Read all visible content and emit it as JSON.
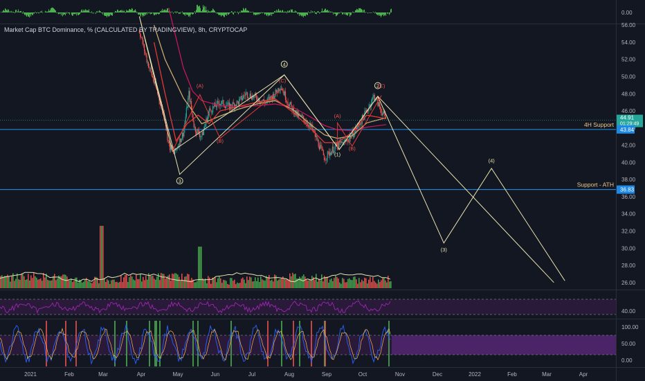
{
  "header": {
    "symbol_title": "Market Cap BTC Dominance, % (CALCULATED BY TRADINGVIEW), 8h, CRYPTOCAP"
  },
  "colors": {
    "background": "#131722",
    "up": "#26a69a",
    "up_volume": "#4caf50",
    "down": "#ef5350",
    "wave_line": "#e8e3b0",
    "ma_pink": "#c2185b",
    "ma_gold": "#c8a96e",
    "ma_red": "#e53935",
    "hline": "#2196f3",
    "rsi": "#9c27b0",
    "stoch_k": "#2962ff",
    "stoch_d": "#ffb74d",
    "axis_text": "#b2b5be",
    "price_badge": "#26a69a",
    "level_badge": "#1e88e5"
  },
  "chart_data": [
    {
      "type": "line",
      "pane": "top-oscillator",
      "y_ticks": [
        "0.00"
      ]
    },
    {
      "type": "candlestick",
      "pane": "main",
      "title": "Market Cap BTC Dominance, % (CALCULATED BY TRADINGVIEW), 8h, CRYPTOCAP",
      "ylim": [
        25.5,
        56.5
      ],
      "y_ticks": [
        "56.00",
        "54.00",
        "52.00",
        "50.00",
        "48.00",
        "46.00",
        "44.00",
        "42.00",
        "40.00",
        "38.00",
        "36.00",
        "34.00",
        "32.00",
        "30.00",
        "28.00",
        "26.00"
      ],
      "x_ticks": [
        "2021",
        "Feb",
        "Mar",
        "Apr",
        "May",
        "Jun",
        "Jul",
        "Aug",
        "Sep",
        "Oct",
        "Nov",
        "Dec",
        "2022",
        "Feb",
        "Mar",
        "Apr"
      ],
      "price_path": [
        [
          0,
          72
        ],
        [
          1,
          70.5
        ],
        [
          2,
          69.8
        ],
        [
          3,
          68
        ],
        [
          4,
          65
        ],
        [
          5,
          62
        ],
        [
          6,
          60
        ],
        [
          7,
          58
        ],
        [
          7.4,
          57
        ],
        [
          8,
          52
        ],
        [
          8.6,
          48
        ],
        [
          9,
          45
        ],
        [
          9.2,
          42
        ],
        [
          9.5,
          41
        ],
        [
          10,
          43.5
        ],
        [
          10.3,
          48
        ],
        [
          10.6,
          44
        ],
        [
          11,
          43
        ],
        [
          11.4,
          46
        ],
        [
          12,
          47
        ],
        [
          12.5,
          46.5
        ],
        [
          13,
          47
        ],
        [
          13.4,
          48
        ],
        [
          14,
          47.5
        ],
        [
          14.5,
          47
        ],
        [
          15,
          48
        ],
        [
          15.3,
          49
        ],
        [
          15.7,
          47
        ],
        [
          16.2,
          45.5
        ],
        [
          16.6,
          45
        ],
        [
          17,
          44
        ],
        [
          17.4,
          42
        ],
        [
          17.7,
          40.5
        ],
        [
          18,
          41.2
        ],
        [
          18.4,
          42
        ],
        [
          18.9,
          42.5
        ],
        [
          19.3,
          43.5
        ],
        [
          19.6,
          44.5
        ],
        [
          20,
          46
        ],
        [
          20.4,
          47.8
        ],
        [
          20.8,
          46
        ],
        [
          21.05,
          45
        ]
      ],
      "moving_averages": [
        {
          "color_key": "ma_pink",
          "points": [
            [
              9.2,
              58
            ],
            [
              10,
              51
            ],
            [
              10.5,
              48.3
            ],
            [
              11,
              47.2
            ],
            [
              12,
              46.6
            ],
            [
              13,
              46.5
            ],
            [
              14,
              46.6
            ],
            [
              15,
              46.8
            ],
            [
              16,
              46.4
            ],
            [
              17,
              45.2
            ],
            [
              17.7,
              44.3
            ],
            [
              18.4,
              43.8
            ],
            [
              19.2,
              43.7
            ],
            [
              20,
              44.1
            ],
            [
              21.05,
              44.4
            ]
          ]
        },
        {
          "color_key": "ma_gold",
          "points": [
            [
              8.4,
              56
            ],
            [
              9,
              52
            ],
            [
              10,
              47.5
            ],
            [
              11,
              44.5
            ],
            [
              12,
              45.4
            ],
            [
              13,
              46.2
            ],
            [
              14,
              46.8
            ],
            [
              15,
              47.2
            ],
            [
              16,
              46.1
            ],
            [
              17,
              44.3
            ],
            [
              17.7,
              43.2
            ],
            [
              18.4,
              42.8
            ],
            [
              19.2,
              43.1
            ],
            [
              20,
              44.6
            ],
            [
              21.05,
              45.2
            ]
          ]
        },
        {
          "color_key": "ma_red",
          "points": [
            [
              8.4,
              54
            ],
            [
              9,
              48
            ],
            [
              9.6,
              42.5
            ],
            [
              10.2,
              44.5
            ],
            [
              10.8,
              45.5
            ],
            [
              11.4,
              44.5
            ],
            [
              12,
              46
            ],
            [
              13,
              46.5
            ],
            [
              14,
              47
            ],
            [
              15,
              47.4
            ],
            [
              16,
              45.8
            ],
            [
              17,
              43.8
            ],
            [
              17.7,
              42.3
            ],
            [
              18.4,
              42.3
            ],
            [
              19.2,
              43.5
            ],
            [
              20,
              45.5
            ],
            [
              21.05,
              45.1
            ]
          ]
        }
      ],
      "elliott_wave": [
        [
          7.6,
          57
        ],
        [
          9.8,
          38.6
        ],
        [
          15.5,
          50.2
        ],
        [
          18.5,
          41.5
        ],
        [
          20.6,
          47.7
        ],
        [
          24.2,
          30.6
        ],
        [
          26.8,
          39.3
        ],
        [
          30.8,
          26.2
        ]
      ],
      "elliott_wave_2": [
        [
          7.6,
          57
        ],
        [
          9.4,
          41.3
        ],
        [
          15.5,
          50.2
        ],
        [
          18.5,
          41.5
        ],
        [
          20.6,
          47.7
        ],
        [
          30.2,
          26
        ]
      ],
      "horizontal_levels": [
        {
          "value": 43.84,
          "label": "4H Support",
          "badge": "43.84"
        },
        {
          "value": 36.83,
          "label": "Support - ATH",
          "badge": "36.83"
        }
      ],
      "last_price": {
        "value": "44.91",
        "countdown": "01:29:49"
      },
      "wave_labels": [
        {
          "text": "3",
          "x": 9.8,
          "y": 37.6,
          "circle": true,
          "color": "#e8e3b0"
        },
        {
          "text": "4",
          "x": 15.5,
          "y": 51.2,
          "circle": true,
          "color": "#e8e3b0"
        },
        {
          "text": "2",
          "x": 20.6,
          "y": 48.7,
          "circle": true,
          "color": "#e8e3b0"
        },
        {
          "text": "(4)",
          "x": 26.8,
          "y": 40.0,
          "circle": false,
          "color": "#e8e3b0"
        },
        {
          "text": "(3)",
          "x": 24.2,
          "y": 29.6,
          "circle": false,
          "color": "#e8e3b0"
        },
        {
          "text": "(1)",
          "x": 18.4,
          "y": 40.7,
          "circle": false,
          "color": "#e8e3b0"
        },
        {
          "text": "(A)",
          "x": 10.9,
          "y": 48.7,
          "circle": false,
          "color": "#ef5350"
        },
        {
          "text": "(B)",
          "x": 12.0,
          "y": 42.3,
          "circle": false,
          "color": "#ef5350"
        },
        {
          "text": "(C)",
          "x": 15.4,
          "y": 49.3,
          "circle": false,
          "color": "#ef5350"
        },
        {
          "text": "(A)",
          "x": 18.4,
          "y": 45.2,
          "circle": false,
          "color": "#ef5350"
        },
        {
          "text": "(B)",
          "x": 19.2,
          "y": 41.4,
          "circle": false,
          "color": "#ef5350"
        },
        {
          "text": "(C)",
          "x": 20.8,
          "y": 48.7,
          "circle": false,
          "color": "#ef5350"
        }
      ]
    },
    {
      "type": "line",
      "pane": "rsi",
      "y_ticks": [
        "40.00"
      ]
    },
    {
      "type": "line",
      "pane": "stochastic",
      "y_ticks": [
        "100.00",
        "50.00",
        "0.00"
      ]
    }
  ]
}
